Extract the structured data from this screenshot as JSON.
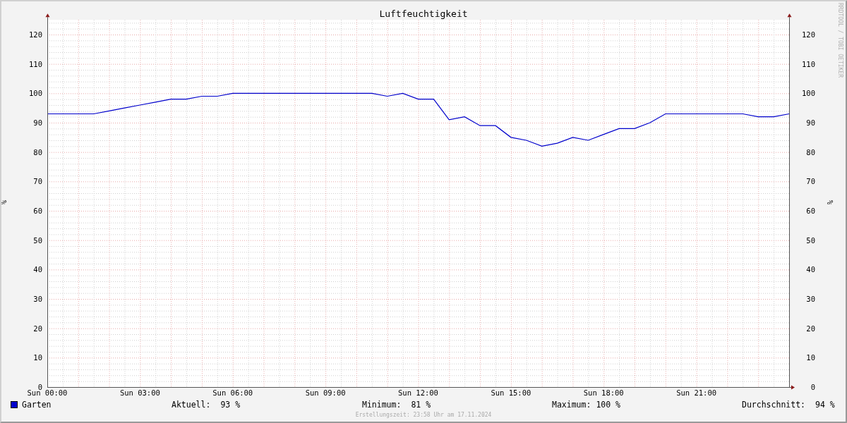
{
  "graph": {
    "chart_data": {
      "type": "line",
      "title": "Luftfeuchtigkeit",
      "ylabel": "%",
      "categories": [
        "Sun 00:00",
        null,
        null,
        null,
        null,
        null,
        "Sun 03:00",
        null,
        null,
        null,
        null,
        null,
        "Sun 06:00",
        null,
        null,
        null,
        null,
        null,
        "Sun 09:00",
        null,
        null,
        null,
        null,
        null,
        "Sun 12:00",
        null,
        null,
        null,
        null,
        null,
        "Sun 15:00",
        null,
        null,
        null,
        null,
        null,
        "Sun 18:00",
        null,
        null,
        null,
        null,
        null,
        "Sun 21:00",
        null,
        null,
        null,
        null,
        null,
        null
      ],
      "series": [
        {
          "name": "Garten",
          "color": "#0000cc",
          "values": [
            93,
            93,
            93,
            93,
            94,
            95,
            96,
            97,
            98,
            98,
            99,
            99,
            100,
            100,
            100,
            100,
            100,
            100,
            100,
            100,
            100,
            100,
            99,
            100,
            98,
            98,
            91,
            92,
            89,
            89,
            85,
            84,
            82,
            83,
            85,
            84,
            86,
            88,
            88,
            90,
            93,
            93,
            93,
            93,
            93,
            93,
            92,
            92,
            93
          ]
        }
      ],
      "ylim": [
        0,
        125
      ],
      "grid": true,
      "yticks": [
        0,
        10,
        20,
        30,
        40,
        50,
        60,
        70,
        80,
        90,
        100,
        110,
        120
      ]
    },
    "right_axis": {
      "label": "%",
      "ticks": [
        "120",
        "110",
        "100",
        "90",
        "80",
        "70",
        "60",
        "50",
        "40",
        "30",
        "20",
        "10",
        "0"
      ]
    },
    "credit": "RRDTOOL / TOBI OETIKER"
  },
  "legend": {
    "stats": [
      {
        "label": "Aktuell:",
        "value": "93 %"
      },
      {
        "label": "Minimum:",
        "value": "81 %"
      },
      {
        "label": "Maximum:",
        "value": "100 %"
      },
      {
        "label": "Durchschnitt:",
        "value": "94 %"
      }
    ]
  },
  "footer": "Erstellungszeit: 23:58 Uhr am 17.11.2024"
}
